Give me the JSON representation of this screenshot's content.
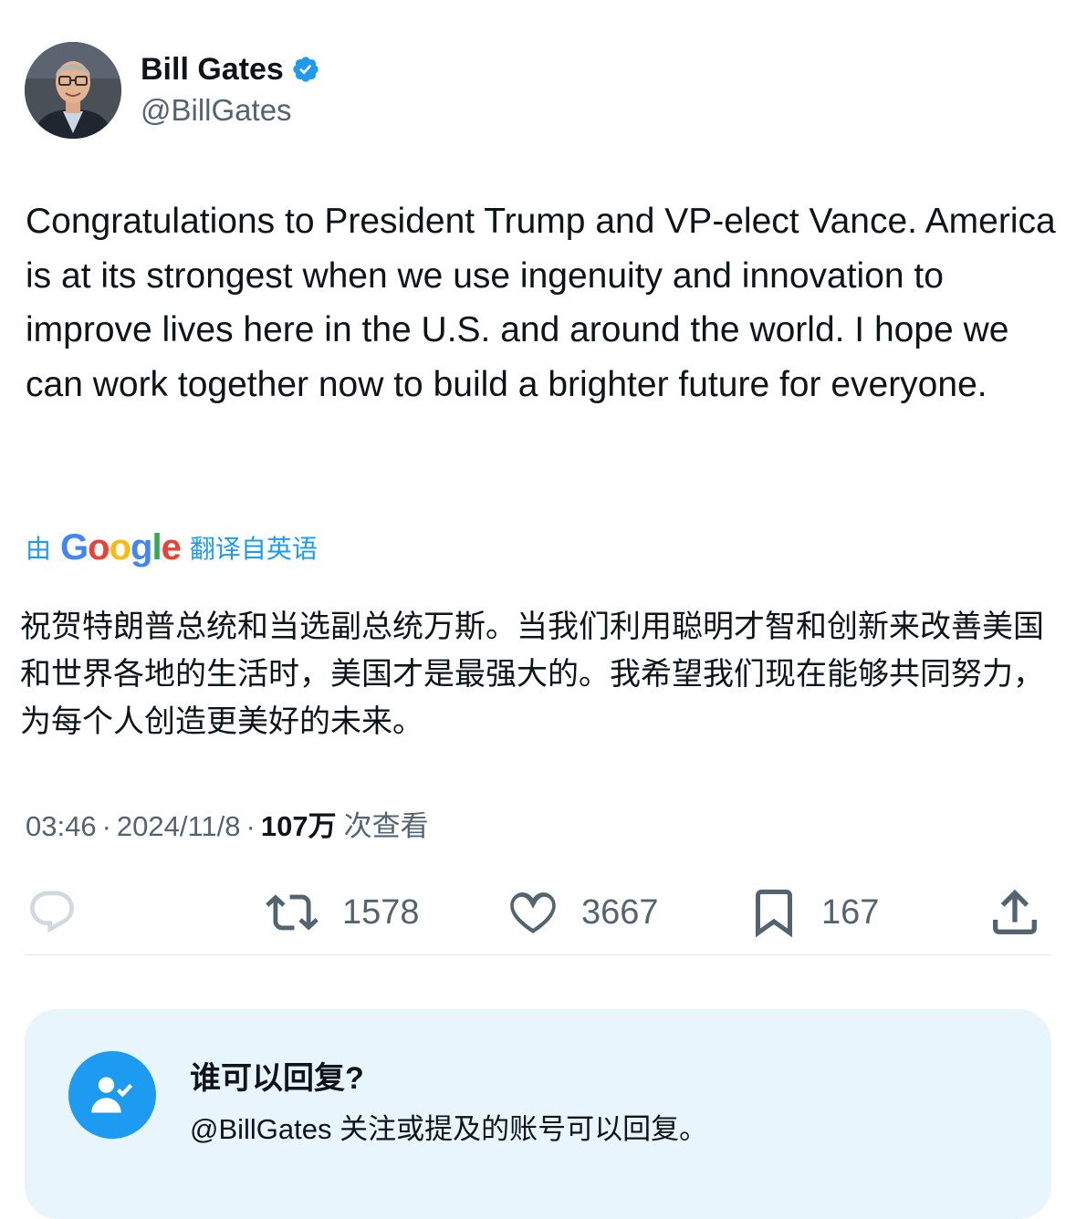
{
  "author": {
    "name": "Bill Gates",
    "handle": "@BillGates",
    "verified": true
  },
  "tweet": {
    "text": "Congratulations to President Trump and VP-elect Vance. America is at its strongest when we use ingenuity and innovation to improve lives here in the U.S. and around the world. I hope we can work together now to build a brighter future for everyone."
  },
  "translation": {
    "by_label": "由",
    "provider": "Google",
    "from_label": "翻译自英语",
    "text": "祝贺特朗普总统和当选副总统万斯。当我们利用聪明才智和创新来改善美国和世界各地的生活时，美国才是最强大的。我希望我们现在能够共同努力，为每个人创造更美好的未来。"
  },
  "meta": {
    "time": "03:46",
    "date": "2024/11/8",
    "separator": "·",
    "views_count": "107万",
    "views_label": "次查看"
  },
  "actions": {
    "retweets": "1578",
    "likes": "3667",
    "bookmarks": "167"
  },
  "reply_settings": {
    "title": "谁可以回复?",
    "description": "@BillGates 关注或提及的账号可以回复。"
  },
  "colors": {
    "accent": "#1d9bf0",
    "secondary_text": "#536471",
    "card_background": "#e8f5fd"
  },
  "icons": {
    "verified": "verified-badge-icon",
    "reply": "reply-icon",
    "retweet": "retweet-icon",
    "like": "heart-icon",
    "bookmark": "bookmark-icon",
    "share": "share-icon",
    "reply_permission": "user-check-icon"
  }
}
